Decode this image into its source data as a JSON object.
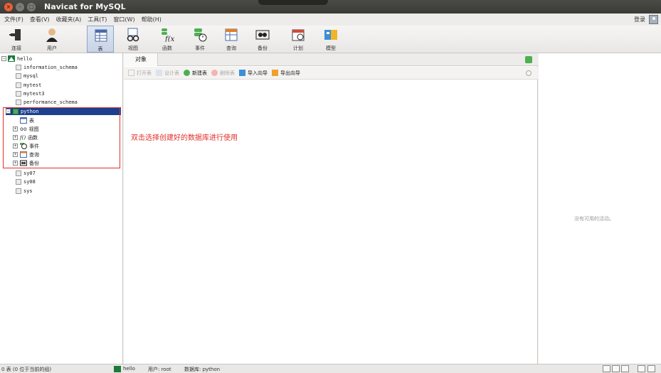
{
  "window": {
    "title": "Navicat for MySQL"
  },
  "menu": [
    "文件(F)",
    "查看(V)",
    "收藏夹(A)",
    "工具(T)",
    "窗口(W)",
    "帮助(H)"
  ],
  "login_label": "登录",
  "toolbar": [
    {
      "label": "连接",
      "icon": "connection-icon"
    },
    {
      "label": "用户",
      "icon": "user-icon"
    },
    {
      "label": "表",
      "icon": "table-icon",
      "active": true
    },
    {
      "label": "视图",
      "icon": "view-icon"
    },
    {
      "label": "函数",
      "icon": "function-icon"
    },
    {
      "label": "事件",
      "icon": "event-icon"
    },
    {
      "label": "查询",
      "icon": "query-icon"
    },
    {
      "label": "备份",
      "icon": "backup-icon"
    },
    {
      "label": "计划",
      "icon": "schedule-icon"
    },
    {
      "label": "模型",
      "icon": "model-icon"
    }
  ],
  "tree": {
    "connection": "hello",
    "databases": [
      "information_schema",
      "mysql",
      "mytest",
      "mytest3",
      "performance_schema"
    ],
    "selected_db": "python",
    "selected_children": [
      "表",
      "视图",
      "函数",
      "事件",
      "查询",
      "备份"
    ],
    "databases_after": [
      "sy07",
      "sy08",
      "sys"
    ]
  },
  "objects": {
    "tab_label": "对象",
    "buttons": [
      {
        "label": "打开表",
        "enabled": false
      },
      {
        "label": "设计表",
        "enabled": false
      },
      {
        "label": "新建表",
        "enabled": true
      },
      {
        "label": "删除表",
        "enabled": false
      },
      {
        "label": "导入向导",
        "enabled": true
      },
      {
        "label": "导出向导",
        "enabled": true
      }
    ],
    "annotation": "双击选择创建好的数据库进行使用"
  },
  "right_panel": {
    "empty_text": "没有可用的活动。"
  },
  "status": {
    "count": "0 表 (0 位于当前的组)",
    "connection": "hello",
    "user": "用户: root",
    "database": "数据库: python"
  },
  "colors": {
    "accent": "#1c3f8e",
    "annotation": "#e0302a"
  }
}
